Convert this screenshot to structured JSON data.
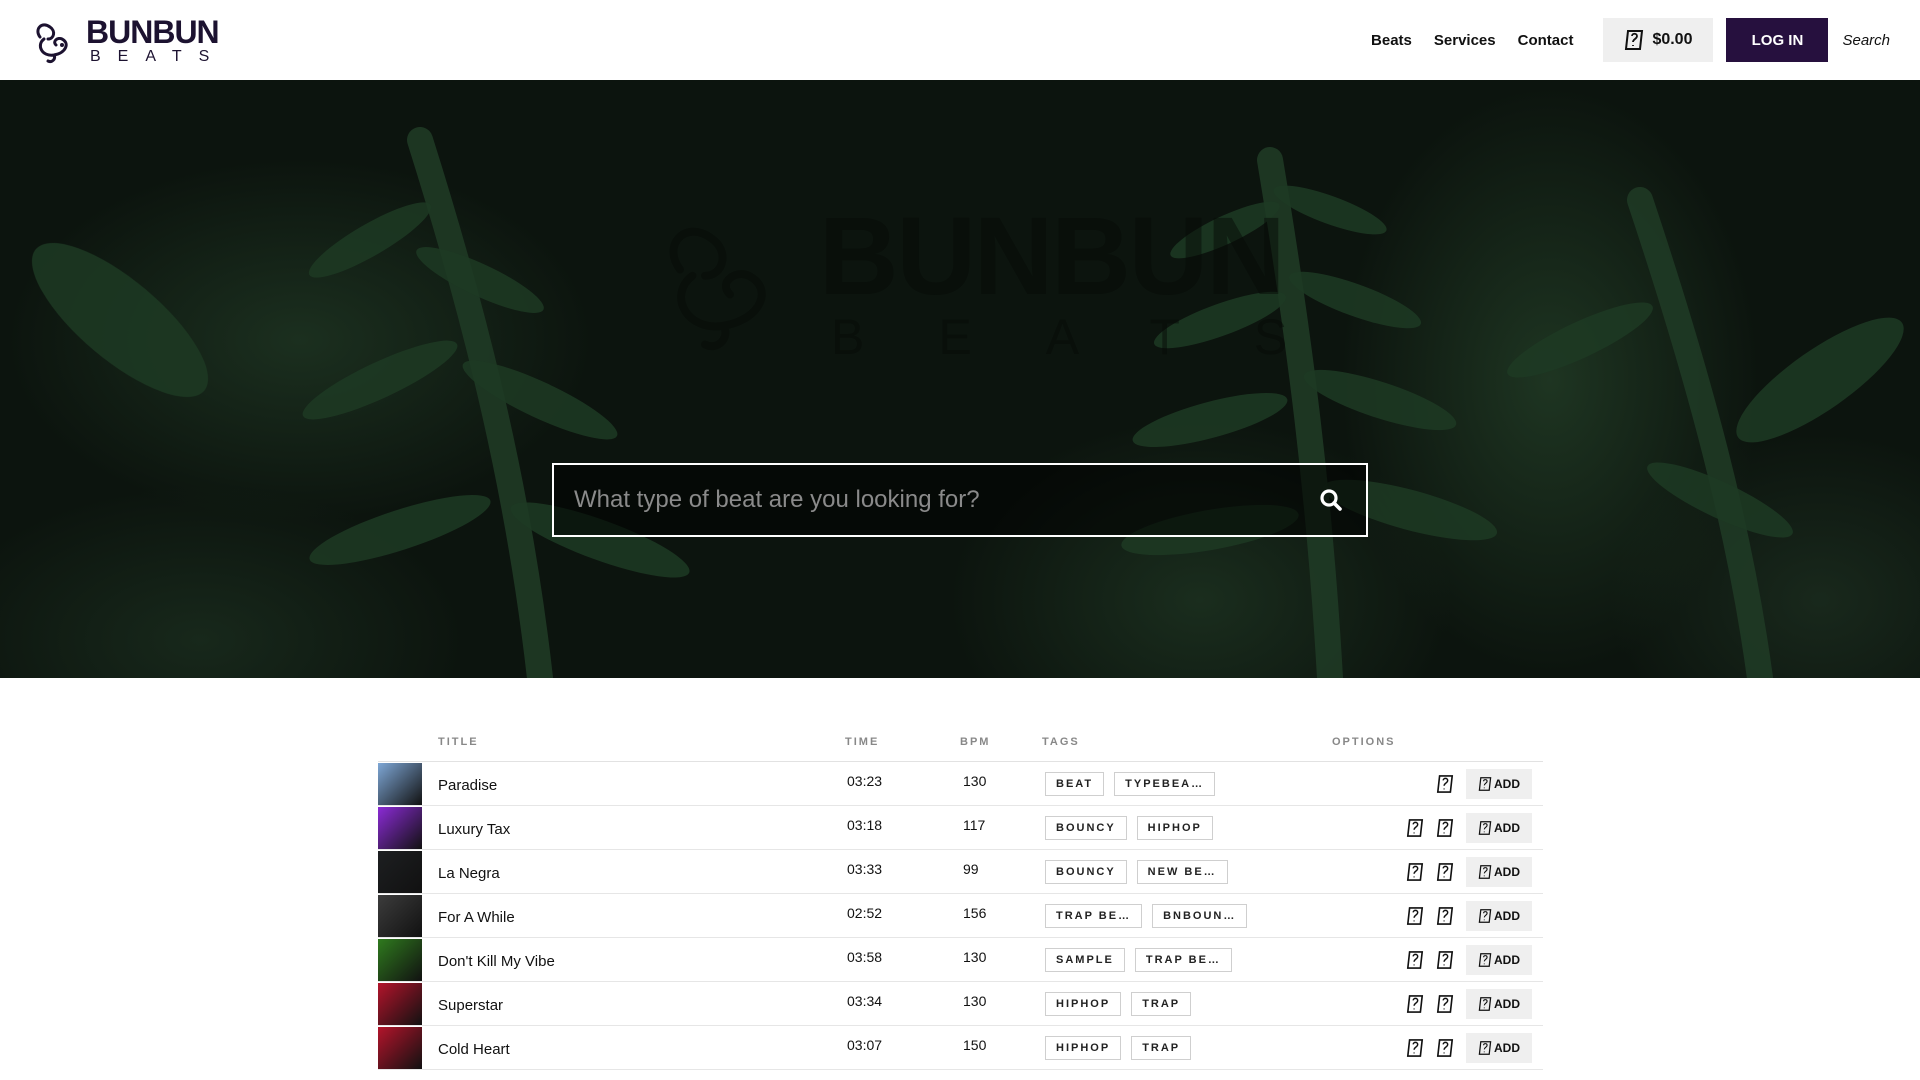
{
  "header": {
    "logo_name": "BUNBUN",
    "logo_sub": "BEATS",
    "nav": [
      "Beats",
      "Services",
      "Contact"
    ],
    "cart_total": "$0.00",
    "login_label": "LOG IN",
    "search_label": "Search"
  },
  "hero": {
    "watermark_name": "BUNBUN",
    "watermark_sub": "BEATS",
    "search_placeholder": "What type of beat are you looking for?"
  },
  "table": {
    "headers": {
      "title": "TITLE",
      "time": "TIME",
      "bpm": "BPM",
      "tags": "TAGS",
      "options": "OPTIONS"
    },
    "add_label": "ADD",
    "rows": [
      {
        "title": "Paradise",
        "time": "03:23",
        "bpm": "130",
        "tags": [
          "BEAT",
          "TYPEBEA…"
        ],
        "thumb_color": "#7ea7d6",
        "options_icons": 1
      },
      {
        "title": "Luxury Tax",
        "time": "03:18",
        "bpm": "117",
        "tags": [
          "BOUNCY",
          "HIPHOP"
        ],
        "thumb_color": "#8b2bd6",
        "options_icons": 2
      },
      {
        "title": "La Negra",
        "time": "03:33",
        "bpm": "99",
        "tags": [
          "BOUNCY",
          "NEW BE…"
        ],
        "thumb_color": "#1d1f21",
        "options_icons": 2
      },
      {
        "title": "For A While",
        "time": "02:52",
        "bpm": "156",
        "tags": [
          "TRAP BE…",
          "BNBOUN…"
        ],
        "thumb_color": "#3c3c3c",
        "options_icons": 2
      },
      {
        "title": "Don't Kill My Vibe",
        "time": "03:58",
        "bpm": "130",
        "tags": [
          "SAMPLE",
          "TRAP BE…"
        ],
        "thumb_color": "#2f7a1e",
        "options_icons": 2
      },
      {
        "title": "Superstar",
        "time": "03:34",
        "bpm": "130",
        "tags": [
          "HIPHOP",
          "TRAP"
        ],
        "thumb_color": "#b3142b",
        "options_icons": 2
      },
      {
        "title": "Cold Heart",
        "time": "03:07",
        "bpm": "150",
        "tags": [
          "HIPHOP",
          "TRAP"
        ],
        "thumb_color": "#b3142b",
        "options_icons": 2
      }
    ]
  }
}
